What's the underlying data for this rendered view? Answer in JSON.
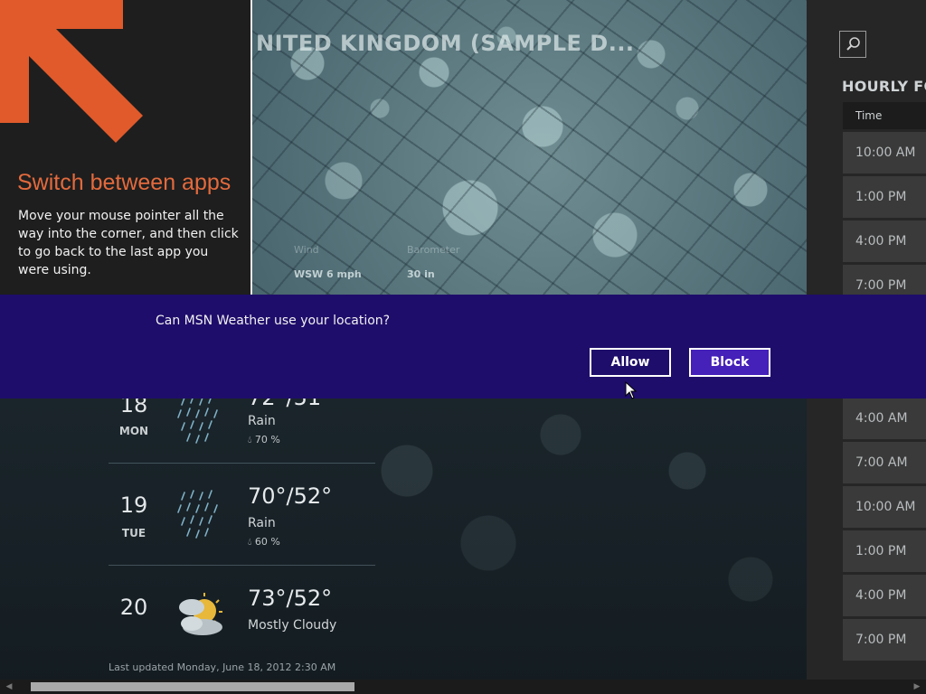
{
  "header": {
    "location_title": "NITED KINGDOM (SAMPLE D..."
  },
  "conditions": {
    "wind_label": "Wind",
    "wind_value": "WSW 6 mph",
    "barometer_label": "Barometer",
    "barometer_value": "30 in"
  },
  "forecast": [
    {
      "date": "18",
      "dow": "MON",
      "temps": "72°/51°",
      "condition": "Rain",
      "precip": "70 %",
      "icon": "rain-icon"
    },
    {
      "date": "19",
      "dow": "TUE",
      "temps": "70°/52°",
      "condition": "Rain",
      "precip": "60 %",
      "icon": "rain-icon"
    },
    {
      "date": "20",
      "dow": "",
      "temps": "73°/52°",
      "condition": "Mostly Cloudy",
      "precip": "",
      "icon": "partly-cloudy-icon"
    }
  ],
  "last_updated": "Last updated Monday, June 18, 2012 2:30 AM",
  "hourly": {
    "title": "HOURLY FO",
    "column_header": "Time",
    "times": [
      "10:00 AM",
      "1:00 PM",
      "4:00 PM",
      "7:00 PM",
      "4:00 AM",
      "7:00 AM",
      "10:00 AM",
      "1:00 PM",
      "4:00 PM",
      "7:00 PM"
    ]
  },
  "switch_tip": {
    "title": "Switch between apps",
    "body": "Move your mouse pointer all the way into the corner, and then click to go back to the last app you were using."
  },
  "permission": {
    "question": "Can MSN Weather use your location?",
    "allow_label": "Allow",
    "block_label": "Block"
  },
  "colors": {
    "permission_bar": "#1f0d6b",
    "block_button": "#4520b9",
    "tip_accent": "#e36a3d"
  }
}
